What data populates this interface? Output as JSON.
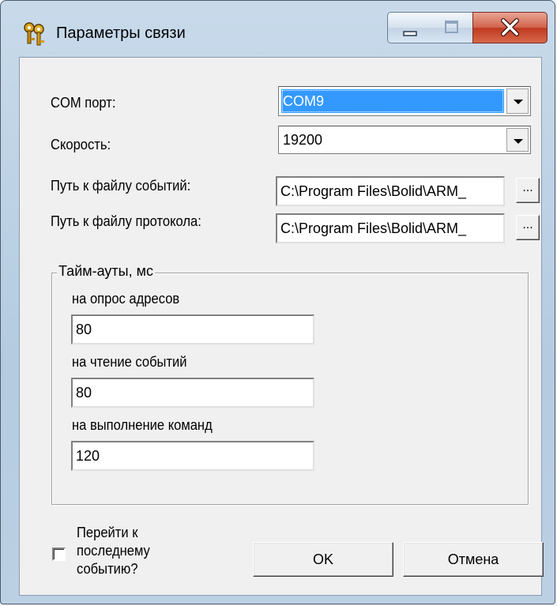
{
  "window": {
    "title": "Параметры связи"
  },
  "com_port": {
    "label": "COM порт:",
    "value": "COM9"
  },
  "speed": {
    "label": "Скорость:",
    "value": "19200"
  },
  "events_path": {
    "label": "Путь к файлу событий:",
    "value": "C:\\Program Files\\Bolid\\ARM_",
    "browse": "..."
  },
  "protocol_path": {
    "label": "Путь к файлу протокола:",
    "value": "C:\\Program Files\\Bolid\\ARM_",
    "browse": "..."
  },
  "timeouts": {
    "title": "Тайм-ауты, мс",
    "address_poll": {
      "label": "на опрос адресов",
      "value": "80"
    },
    "event_read": {
      "label": "на чтение событий",
      "value": "80"
    },
    "command_exec": {
      "label": "на выполнение команд",
      "value": "120"
    }
  },
  "goto_last": {
    "label": "Перейти к последнему событию?",
    "checked": false
  },
  "buttons": {
    "ok": "OK",
    "cancel": "Отмена"
  },
  "icons": {
    "app": "keys-icon",
    "minimize": "minimize-icon",
    "maximize": "maximize-icon",
    "close": "close-icon"
  },
  "colors": {
    "selection": "#3399ff",
    "close_button": "#c0391f",
    "frame": "#b4cbe0"
  }
}
